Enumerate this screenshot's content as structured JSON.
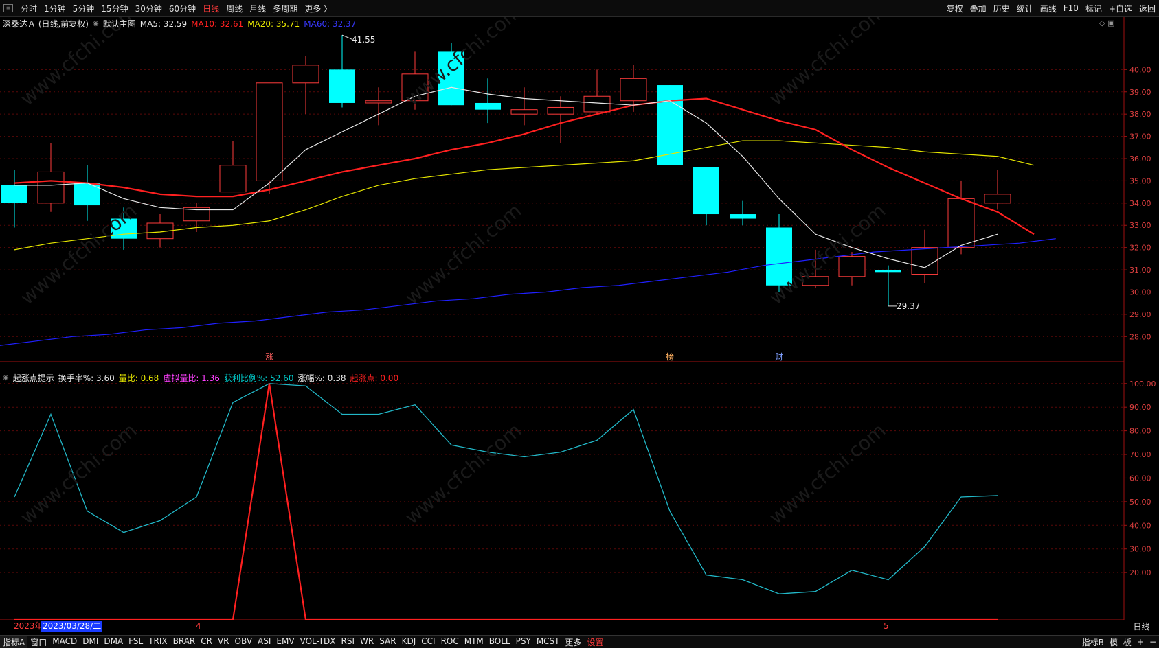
{
  "topbar": {
    "periods": [
      "分时",
      "1分钟",
      "5分钟",
      "15分钟",
      "30分钟",
      "60分钟",
      "日线",
      "周线",
      "月线",
      "多周期",
      "更多 〉"
    ],
    "active_period": "日线",
    "right_tools": [
      "复权",
      "叠加",
      "历史",
      "统计",
      "画线",
      "F10",
      "标记",
      "+自选",
      "返回"
    ]
  },
  "main_legend": {
    "stock": "深桑达Ａ (日线,前复权)",
    "chart_name": "默认主图",
    "ma5": "MA5: 32.59",
    "ma10": "MA10: 32.61",
    "ma20": "MA20: 35.71",
    "ma60": "MA60: 32.37"
  },
  "sub_legend": {
    "name": "起涨点提示",
    "turnover": "换手率%: 3.60",
    "vol_ratio": "量比: 0.68",
    "virtual_ratio": "虚拟量比: 1.36",
    "profit_ratio": "获利比例%: 52.60",
    "change": "涨幅%: 0.38",
    "start_point": "起涨点: 0.00"
  },
  "annotations": {
    "high": "41.55",
    "low": "29.37"
  },
  "markers": [
    "涨",
    "榜",
    "财"
  ],
  "x_axis": {
    "year_label": "2023年",
    "cursor_date": "2023/03/28/二",
    "month4": "4",
    "month5": "5",
    "period_label": "日线"
  },
  "bottombar": {
    "tabs": [
      "指标A",
      "窗口",
      "MACD",
      "DMI",
      "DMA",
      "FSL",
      "TRIX",
      "BRAR",
      "CR",
      "VR",
      "OBV",
      "ASI",
      "EMV",
      "VOL-TDX",
      "RSI",
      "WR",
      "SAR",
      "KDJ",
      "CCI",
      "ROC",
      "MTM",
      "BOLL",
      "PSY",
      "MCST",
      "更多",
      "设置"
    ],
    "right_tabs": [
      "指标B",
      "模",
      "板",
      "+",
      "−"
    ]
  },
  "colors": {
    "up": "#ff3b3b",
    "down": "#00ffff",
    "ma5": "#e6e6e6",
    "ma10": "#ff2020",
    "ma20": "#e6e600",
    "ma60": "#2020ff"
  },
  "chart_data": [
    {
      "type": "candlestick",
      "title": "深桑达Ａ (日线,前复权)",
      "y_ticks": [
        28,
        29,
        30,
        31,
        32,
        33,
        34,
        35,
        36,
        37,
        38,
        39,
        40
      ],
      "y_tick_labels": [
        "28.00",
        "29.00",
        "30.00",
        "31.00",
        "32.00",
        "33.00",
        "34.00",
        "35.00",
        "36.00",
        "37.00",
        "38.00",
        "39.00",
        "40.00"
      ],
      "ylim": [
        27.3,
        41.8
      ],
      "candles": [
        {
          "o": 34.8,
          "c": 34.0,
          "h": 35.5,
          "l": 32.9
        },
        {
          "o": 34.0,
          "c": 35.4,
          "h": 36.7,
          "l": 33.6
        },
        {
          "o": 34.9,
          "c": 33.9,
          "h": 35.7,
          "l": 33.2
        },
        {
          "o": 33.3,
          "c": 32.4,
          "h": 33.8,
          "l": 31.9
        },
        {
          "o": 32.4,
          "c": 33.1,
          "h": 33.5,
          "l": 32.0
        },
        {
          "o": 33.2,
          "c": 33.8,
          "h": 34.0,
          "l": 32.7
        },
        {
          "o": 34.5,
          "c": 35.7,
          "h": 36.8,
          "l": 34.5
        },
        {
          "o": 35.0,
          "c": 39.4,
          "h": 39.4,
          "l": 34.4
        },
        {
          "o": 39.4,
          "c": 40.2,
          "h": 40.6,
          "l": 38.0
        },
        {
          "o": 40.0,
          "c": 38.5,
          "h": 41.55,
          "l": 38.3
        },
        {
          "o": 38.5,
          "c": 38.6,
          "h": 39.2,
          "l": 37.5
        },
        {
          "o": 38.6,
          "c": 39.8,
          "h": 40.8,
          "l": 38.2
        },
        {
          "o": 40.8,
          "c": 38.4,
          "h": 41.2,
          "l": 38.4
        },
        {
          "o": 38.5,
          "c": 38.2,
          "h": 39.6,
          "l": 37.6
        },
        {
          "o": 38.0,
          "c": 38.2,
          "h": 39.2,
          "l": 37.5
        },
        {
          "o": 38.0,
          "c": 38.3,
          "h": 38.8,
          "l": 36.7
        },
        {
          "o": 38.1,
          "c": 38.8,
          "h": 40.0,
          "l": 38.0
        },
        {
          "o": 38.6,
          "c": 39.6,
          "h": 40.2,
          "l": 38.1
        },
        {
          "o": 39.3,
          "c": 35.7,
          "h": 39.3,
          "l": 35.7
        },
        {
          "o": 35.6,
          "c": 33.5,
          "h": 35.6,
          "l": 33.0
        },
        {
          "o": 33.5,
          "c": 33.3,
          "h": 34.1,
          "l": 33.0
        },
        {
          "o": 32.9,
          "c": 30.3,
          "h": 33.5,
          "l": 30.0
        },
        {
          "o": 30.3,
          "c": 30.7,
          "h": 31.9,
          "l": 30.2
        },
        {
          "o": 30.7,
          "c": 31.6,
          "h": 31.8,
          "l": 30.3
        },
        {
          "o": 31.0,
          "c": 30.9,
          "h": 31.2,
          "l": 29.37
        },
        {
          "o": 30.8,
          "c": 32.0,
          "h": 32.8,
          "l": 30.4
        },
        {
          "o": 32.0,
          "c": 34.2,
          "h": 35.0,
          "l": 31.7
        },
        {
          "o": 34.0,
          "c": 34.4,
          "h": 35.5,
          "l": 33.7
        }
      ],
      "ma5": [
        34.8,
        34.8,
        34.9,
        34.2,
        33.8,
        33.7,
        33.7,
        34.9,
        36.4,
        37.2,
        38.0,
        38.8,
        39.2,
        38.9,
        38.7,
        38.6,
        38.5,
        38.4,
        38.6,
        37.6,
        36.1,
        34.2,
        32.6,
        32.0,
        31.5,
        31.1,
        32.1,
        32.6
      ],
      "ma10": [
        34.9,
        35.0,
        34.9,
        34.7,
        34.4,
        34.3,
        34.3,
        34.6,
        35.0,
        35.4,
        35.7,
        36.0,
        36.4,
        36.7,
        37.1,
        37.6,
        38.0,
        38.4,
        38.6,
        38.7,
        38.2,
        37.7,
        37.3,
        36.4,
        35.6,
        34.9,
        34.2,
        33.6,
        32.6
      ],
      "ma20": [
        31.9,
        32.2,
        32.4,
        32.6,
        32.7,
        32.9,
        33.0,
        33.2,
        33.7,
        34.3,
        34.8,
        35.1,
        35.3,
        35.5,
        35.6,
        35.7,
        35.8,
        35.9,
        36.2,
        36.5,
        36.8,
        36.8,
        36.7,
        36.6,
        36.5,
        36.3,
        36.2,
        36.1,
        35.7
      ],
      "ma60": [
        27.6,
        27.8,
        28.0,
        28.1,
        28.3,
        28.4,
        28.6,
        28.7,
        28.9,
        29.1,
        29.2,
        29.4,
        29.6,
        29.7,
        29.9,
        30.0,
        30.2,
        30.3,
        30.5,
        30.7,
        30.9,
        31.2,
        31.4,
        31.6,
        31.8,
        31.9,
        32.0,
        32.1,
        32.2,
        32.4
      ]
    },
    {
      "type": "line",
      "title": "起涨点提示",
      "y_ticks": [
        20,
        30,
        40,
        50,
        60,
        70,
        80,
        90,
        100
      ],
      "y_tick_labels": [
        "20.00",
        "30.00",
        "40.00",
        "50.00",
        "60.00",
        "70.00",
        "80.00",
        "90.00",
        "100.00"
      ],
      "ylim": [
        0,
        104
      ],
      "series": [
        {
          "name": "获利比例%",
          "values": [
            52,
            87,
            46,
            37,
            42,
            52,
            92,
            100,
            99,
            87,
            87,
            91,
            74,
            71,
            69,
            71,
            76,
            89,
            46,
            19,
            17,
            11,
            12,
            21,
            17,
            31,
            52,
            52.6
          ]
        },
        {
          "name": "起涨点",
          "values": [
            0,
            0,
            0,
            0,
            0,
            0,
            0,
            100,
            0,
            0,
            0,
            0,
            0,
            0,
            0,
            0,
            0,
            0,
            0,
            0,
            0,
            0,
            0,
            0,
            0,
            0,
            0,
            0
          ]
        }
      ]
    }
  ]
}
